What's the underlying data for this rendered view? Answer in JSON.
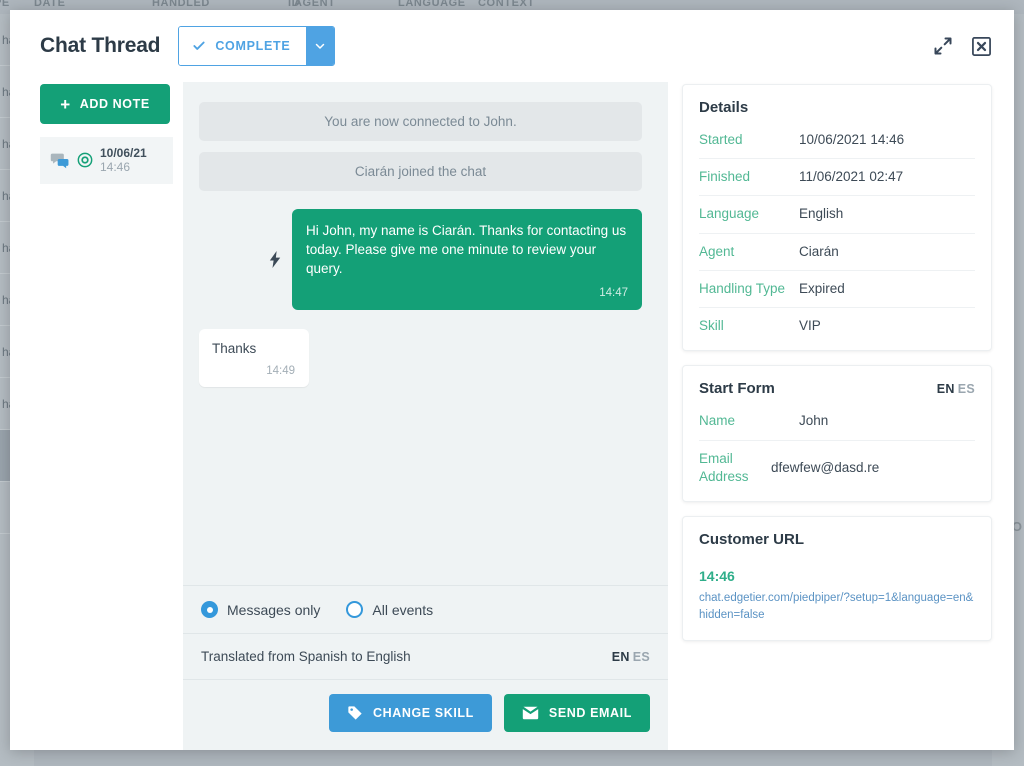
{
  "background": {
    "table_headers": [
      "PE",
      "DATE",
      "HANDLED",
      "ID",
      "AGENT",
      "LANGUAGE",
      "CONTEXT"
    ],
    "row_label": "hat",
    "right_label": "NO"
  },
  "header": {
    "title": "Chat Thread",
    "status_label": "COMPLETE",
    "status_check_icon": "check-icon",
    "status_caret_icon": "chevron-down-icon",
    "expand_icon": "expand-icon",
    "close_icon": "close-box-icon"
  },
  "notes": {
    "add_label": "ADD NOTE",
    "add_icon": "plus-icon",
    "items": [
      {
        "chat_icon": "chat-bubbles-icon",
        "target_icon": "target-icon",
        "date": "10/06/21",
        "time": "14:46"
      }
    ]
  },
  "chat": {
    "messages": [
      {
        "kind": "system",
        "text": "You are now connected to John."
      },
      {
        "kind": "system",
        "text": "Ciarán joined the chat"
      },
      {
        "kind": "agent",
        "icon": "lightning-bolt-icon",
        "text": "Hi John, my name is Ciarán. Thanks for contacting us today. Please give me one minute to review your query.",
        "time": "14:47"
      },
      {
        "kind": "customer",
        "text": "Thanks",
        "time": "14:49"
      }
    ],
    "filters": [
      {
        "label": "Messages only",
        "selected": true
      },
      {
        "label": "All events",
        "selected": false
      }
    ],
    "translation_note": "Translated from Spanish to English",
    "translation_lang_on": "EN",
    "translation_lang_off": "ES",
    "actions": [
      {
        "label": "CHANGE SKILL",
        "icon": "tag-icon",
        "color": "#3d9ad7"
      },
      {
        "label": "SEND EMAIL",
        "icon": "envelope-icon",
        "color": "#14a077"
      }
    ]
  },
  "details": {
    "title": "Details",
    "rows": [
      {
        "key": "Started",
        "value": "10/06/2021 14:46"
      },
      {
        "key": "Finished",
        "value": "11/06/2021 02:47"
      },
      {
        "key": "Language",
        "value": "English"
      },
      {
        "key": "Agent",
        "value": "Ciarán"
      },
      {
        "key": "Handling Type",
        "value": "Expired"
      },
      {
        "key": "Skill",
        "value": "VIP"
      }
    ]
  },
  "start_form": {
    "title": "Start Form",
    "lang_on": "EN",
    "lang_off": "ES",
    "rows": [
      {
        "key": "Name",
        "value": "John"
      },
      {
        "key": "Email Address",
        "value": "dfewfew@dasd.re"
      }
    ]
  },
  "customer_url": {
    "title": "Customer URL",
    "time": "14:46",
    "url": "chat.edgetier.com/piedpiper/?setup=1&language=en&hidden=false"
  },
  "colors": {
    "green": "#14a077",
    "blue": "#3d9ad7",
    "status_blue": "#4fa3e3",
    "key_green": "#52b894",
    "link_blue": "#5b93c4",
    "dark": "#2d3b47"
  }
}
